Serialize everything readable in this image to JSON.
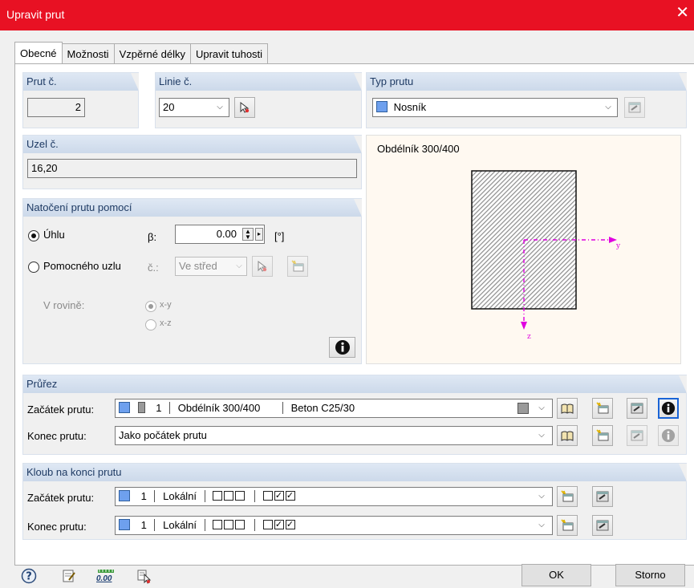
{
  "window": {
    "title": "Upravit prut",
    "close_glyph": "✕"
  },
  "tabs": [
    "Obecné",
    "Možnosti",
    "Vzpěrné délky",
    "Upravit tuhosti"
  ],
  "member": {
    "label": "Prut č.",
    "value": "2"
  },
  "line": {
    "label": "Linie č.",
    "value": "20"
  },
  "member_type": {
    "label": "Typ prutu",
    "value": "Nosník",
    "color": "#6ea0ee"
  },
  "node": {
    "label": "Uzel č.",
    "value": "16,20"
  },
  "rotation": {
    "header": "Natočení prutu pomocí",
    "angle_label": "Úhlu",
    "beta_label": "β:",
    "beta_value": "0.00",
    "unit": "[°]",
    "helper_label": "Pomocného uzlu",
    "node_label": "č.:",
    "node_value": "Ve střed",
    "plane_label": "V rovině:",
    "plane_xy": "x-y",
    "plane_xz": "x-z",
    "selected": "Úhlu"
  },
  "preview": {
    "title": "Obdélník 300/400",
    "axis_y": "y",
    "axis_z": "z"
  },
  "cross_section": {
    "header": "Průřez",
    "start_label": "Začátek prutu:",
    "start_number": "1",
    "start_name": "Obdélník 300/400",
    "start_material": "Beton C25/30",
    "end_label": "Konec prutu:",
    "end_value": "Jako počátek prutu"
  },
  "hinge": {
    "header": "Kloub na konci prutu",
    "start_label": "Začátek prutu:",
    "end_label": "Konec prutu:",
    "start_number": "1",
    "end_number": "1",
    "system": "Lokální",
    "start_checks": [
      false,
      false,
      false,
      false,
      true,
      true
    ],
    "end_checks": [
      false,
      false,
      false,
      false,
      true,
      true
    ]
  },
  "footer": {
    "ok": "OK",
    "cancel": "Storno",
    "units_label": "0.00"
  },
  "colors": {
    "titlebar": "#e81123",
    "group_header": "#dfe8f4",
    "axis": "#e000e0"
  }
}
